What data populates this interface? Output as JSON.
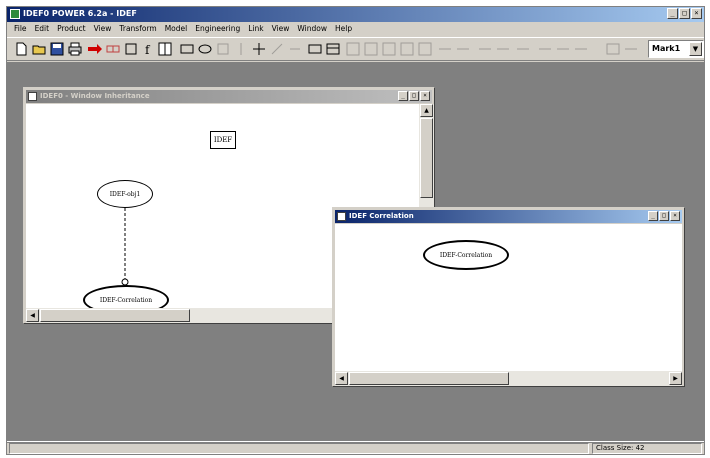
{
  "app": {
    "title": "IDEF0 POWER 6.2a - IDEF",
    "window_buttons": {
      "minimize": "_",
      "maximize": "□",
      "close": "×"
    }
  },
  "menu": [
    "File",
    "Edit",
    "Product",
    "View",
    "Transform",
    "Model",
    "Engineering",
    "Link",
    "View",
    "Window",
    "Help"
  ],
  "toolbar": {
    "combo_value": "Mark1",
    "combo_arrow": "▼",
    "icons": [
      "new-icon",
      "open-icon",
      "save-icon",
      "print-icon",
      "arrow-red-icon",
      "link-icon",
      "box-icon",
      "function-icon",
      "split-icon",
      "rect-icon",
      "ellipse-icon",
      "shape-icon",
      "cross-icon",
      "connector-icon",
      "layout-icon",
      "align-icon",
      "grid-icon",
      "zoom-icon",
      "table-icon"
    ]
  },
  "windows": [
    {
      "title": "IDEF0 - Window Inheritance",
      "active": false,
      "nodes": {
        "box": "IDEF",
        "ellipse_top": "IDEF-obj1",
        "ellipse_bottom": "IDEF-Correlation"
      }
    },
    {
      "title": "IDEF Correlation",
      "active": true,
      "nodes": {
        "ellipse": "IDEF-Correlation"
      }
    }
  ],
  "status": {
    "left": "",
    "right": "Class Size: 42"
  }
}
